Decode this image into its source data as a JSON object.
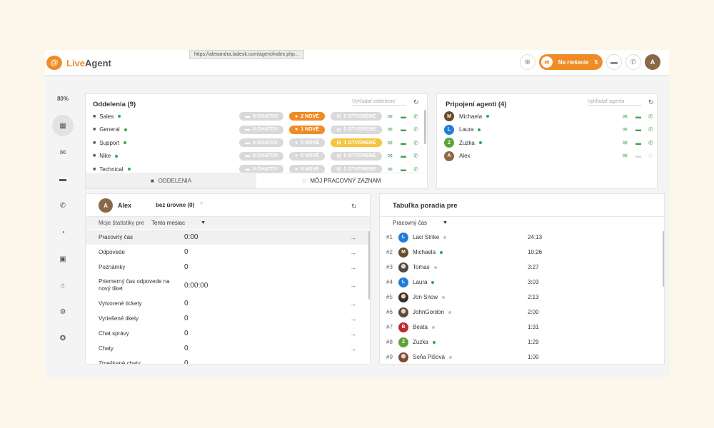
{
  "browser": {
    "url": "https://alexandra.ladesk.com/agent/index.php..."
  },
  "logo": {
    "mark": "@",
    "brand_live": "Live",
    "brand_agent": "Agent"
  },
  "topbar": {
    "status_pill": {
      "label": "Na riešenie",
      "count": "5"
    },
    "user_initial": "A"
  },
  "sidebar": {
    "percent": "80%"
  },
  "departments": {
    "title": "Oddelenia (9)",
    "search_placeholder": "Vyhľadať oddelenie",
    "rows": [
      {
        "name": "Sales",
        "chats": "0 CHATOV",
        "new": "2 NOVÉ",
        "open": "0 OTVORENÉ",
        "new_style": "orange",
        "open_style": "grey"
      },
      {
        "name": "General",
        "chats": "0 CHATOV",
        "new": "1 NOVÉ",
        "open": "0 OTVORENÉ",
        "new_style": "orange",
        "open_style": "grey"
      },
      {
        "name": "Support",
        "chats": "0 CHATOV",
        "new": "0 NOVÉ",
        "open": "1 OTVORENÉ",
        "new_style": "grey",
        "open_style": "yellow"
      },
      {
        "name": "Nike",
        "chats": "0 CHATOV",
        "new": "0 NOVÉ",
        "open": "0 OTVORENÉ",
        "new_style": "grey",
        "open_style": "grey"
      },
      {
        "name": "Technical",
        "chats": "0 CHATOV",
        "new": "0 NOVÉ",
        "open": "0 OTVORENÉ",
        "new_style": "grey",
        "open_style": "grey"
      }
    ],
    "tab_departments": "ODDELENIA",
    "tab_worklog": "MÔJ PRACOVNÝ ZÁZNAM"
  },
  "agents": {
    "title": "Pripojení agenti (4)",
    "search_placeholder": "Vyhľadať agenta",
    "rows": [
      {
        "initial": "M",
        "name": "Michaela",
        "color": "#6b4a2a",
        "online": true
      },
      {
        "initial": "L",
        "name": "Laura",
        "color": "#1f7fd6",
        "online": true
      },
      {
        "initial": "Z",
        "name": "Zuzka",
        "color": "#5ea33a",
        "online": true
      },
      {
        "initial": "A",
        "name": "Alex",
        "color": "#8a6846",
        "online": false
      }
    ]
  },
  "stats": {
    "user_initial": "A",
    "user_name": "Alex",
    "level": "bez úrovne (0)",
    "help": "?",
    "period_label": "Moje štatistiky pre",
    "period_value": "Tento mesiac",
    "rows": [
      {
        "label": "Pracovný čas",
        "value": "0:00"
      },
      {
        "label": "Odpovede",
        "value": "0"
      },
      {
        "label": "Poznámky",
        "value": "0"
      },
      {
        "label": "Priemerný čas odpovede na nový tiket",
        "value": "0:00:00"
      },
      {
        "label": "Vytvorené tickety",
        "value": "0"
      },
      {
        "label": "Vyriešené tikety",
        "value": "0"
      },
      {
        "label": "Chat správy",
        "value": "0"
      },
      {
        "label": "Chaty",
        "value": "0"
      },
      {
        "label": "Zmeškané chaty",
        "value": "0"
      }
    ]
  },
  "leaderboard": {
    "title": "Tabuľka poradia pre",
    "metric": "Pracovný čas",
    "rows": [
      {
        "rank": "#1",
        "name": "Laci Strike",
        "time": "24:13",
        "initial": "L",
        "color": "#1f7fd6",
        "photo": false,
        "online": false
      },
      {
        "rank": "#2",
        "name": "Michaela",
        "time": "10:26",
        "initial": "M",
        "color": "#6b4a2a",
        "photo": false,
        "online": true
      },
      {
        "rank": "#3",
        "name": "Tomas",
        "time": "3:27",
        "initial": "",
        "color": "#4a4a4a",
        "photo": true,
        "online": false
      },
      {
        "rank": "#4",
        "name": "Laura",
        "time": "3:03",
        "initial": "L",
        "color": "#1f7fd6",
        "photo": false,
        "online": true
      },
      {
        "rank": "#5",
        "name": "Jon Snow",
        "time": "2:13",
        "initial": "",
        "color": "#3a3028",
        "photo": true,
        "online": false
      },
      {
        "rank": "#6",
        "name": "JohnGordon",
        "time": "2:00",
        "initial": "",
        "color": "#5a4a40",
        "photo": true,
        "online": false
      },
      {
        "rank": "#7",
        "name": "Beata",
        "time": "1:31",
        "initial": "B",
        "color": "#c0282e",
        "photo": false,
        "online": false
      },
      {
        "rank": "#8",
        "name": "Zuzka",
        "time": "1:29",
        "initial": "Z",
        "color": "#5ea33a",
        "photo": false,
        "online": true
      },
      {
        "rank": "#9",
        "name": "Soňa Pišová",
        "time": "1:00",
        "initial": "",
        "color": "#7a4a3a",
        "photo": true,
        "online": false
      }
    ]
  },
  "colors": {
    "accent": "#f08c25",
    "online": "#3aa54a",
    "offline": "#c4c4c4",
    "action_green": "#3aa54a"
  }
}
